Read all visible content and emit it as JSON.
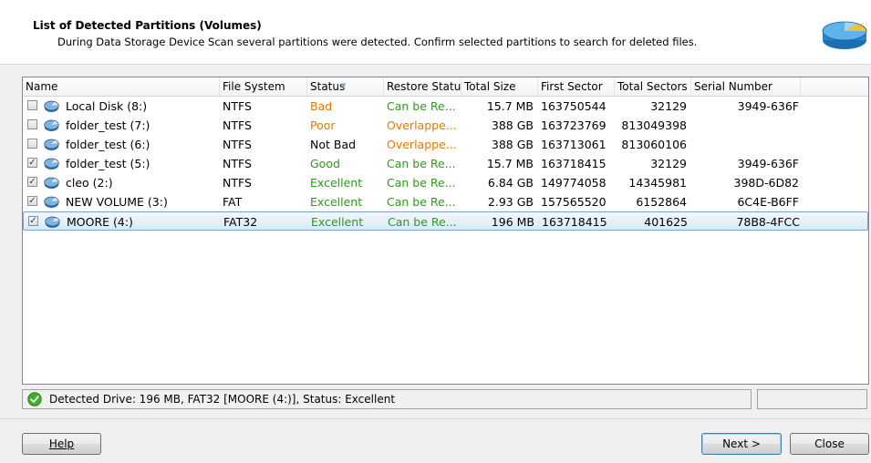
{
  "header": {
    "title": "List of Detected Partitions (Volumes)",
    "description": "During Data Storage Device Scan several partitions were detected. Confirm selected partitions to search for deleted files."
  },
  "columns": [
    {
      "key": "name",
      "label": "Name"
    },
    {
      "key": "fs",
      "label": "File System"
    },
    {
      "key": "status",
      "label": "Status"
    },
    {
      "key": "restore",
      "label": "Restore Statu"
    },
    {
      "key": "size",
      "label": "Total Size"
    },
    {
      "key": "first",
      "label": "First Sector"
    },
    {
      "key": "sectors",
      "label": "Total Sectors"
    },
    {
      "key": "serial",
      "label": "Serial Number"
    }
  ],
  "rows": [
    {
      "checked": false,
      "name": "Local Disk (8:)",
      "fs": "NTFS",
      "status": "Bad",
      "status_color": "#e07b00",
      "restore": "Can be Re...",
      "restore_color": "#2e9a1a",
      "size": "15.7 MB",
      "first": "163750544",
      "sectors": "32129",
      "serial": "3949-636F",
      "selected": false
    },
    {
      "checked": false,
      "name": "folder_test (7:)",
      "fs": "NTFS",
      "status": "Poor",
      "status_color": "#e07b00",
      "restore": "Overlappe...",
      "restore_color": "#e07b00",
      "size": "388 GB",
      "first": "163723769",
      "sectors": "813049398",
      "serial": "",
      "selected": false
    },
    {
      "checked": false,
      "name": "folder_test (6:)",
      "fs": "NTFS",
      "status": "Not Bad",
      "status_color": "#000000",
      "restore": "Overlappe...",
      "restore_color": "#e07b00",
      "size": "388 GB",
      "first": "163713061",
      "sectors": "813060106",
      "serial": "",
      "selected": false
    },
    {
      "checked": true,
      "name": "folder_test (5:)",
      "fs": "NTFS",
      "status": "Good",
      "status_color": "#2e9a1a",
      "restore": "Can be Re...",
      "restore_color": "#2e9a1a",
      "size": "15.7 MB",
      "first": "163718415",
      "sectors": "32129",
      "serial": "3949-636F",
      "selected": false
    },
    {
      "checked": true,
      "name": "cleo (2:)",
      "fs": "NTFS",
      "status": "Excellent",
      "status_color": "#2e9a1a",
      "restore": "Can be Re...",
      "restore_color": "#2e9a1a",
      "size": "6.84 GB",
      "first": "149774058",
      "sectors": "14345981",
      "serial": "398D-6D82",
      "selected": false
    },
    {
      "checked": true,
      "name": "NEW VOLUME (3:)",
      "fs": "FAT",
      "status": "Excellent",
      "status_color": "#2e9a1a",
      "restore": "Can be Re...",
      "restore_color": "#2e9a1a",
      "size": "2.93 GB",
      "first": "157565520",
      "sectors": "6152864",
      "serial": "6C4E-B6FF",
      "selected": false
    },
    {
      "checked": true,
      "name": "MOORE (4:)",
      "fs": "FAT32",
      "status": "Excellent",
      "status_color": "#2e9a1a",
      "restore": "Can be Re...",
      "restore_color": "#2e9a1a",
      "size": "196 MB",
      "first": "163718415",
      "sectors": "401625",
      "serial": "78B8-4FCC",
      "selected": true
    }
  ],
  "status_bar": {
    "text": "Detected Drive: 196 MB, FAT32 [MOORE (4:)], Status: Excellent",
    "icon": "check-circle-icon",
    "side_text": ""
  },
  "buttons": {
    "help": "Help",
    "next": "Next >",
    "close": "Close"
  },
  "colors": {
    "selection_border": "#7da2ce",
    "good": "#2e9a1a",
    "warning": "#e07b00"
  }
}
